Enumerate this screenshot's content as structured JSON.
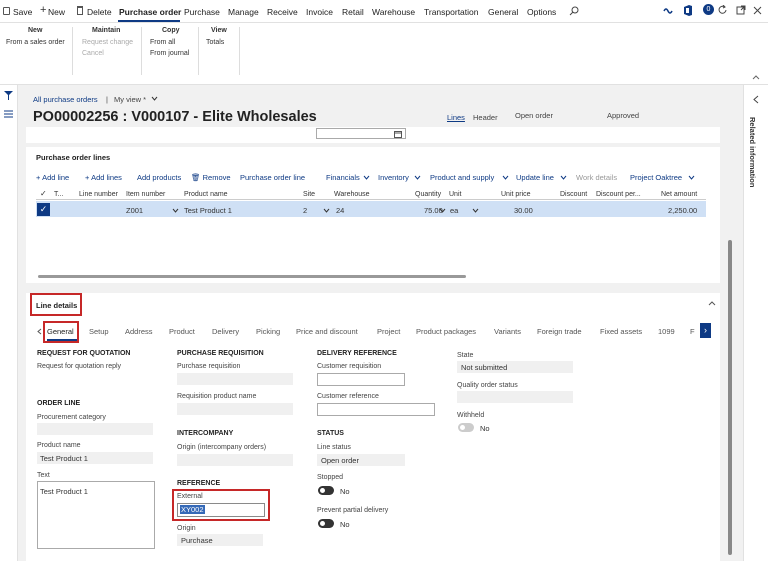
{
  "toolbar": {
    "save": "Save",
    "new": "New",
    "delete": "Delete",
    "tabs": [
      "Purchase order",
      "Purchase",
      "Manage",
      "Receive",
      "Invoice",
      "Retail",
      "Warehouse",
      "Transportation",
      "General",
      "Options"
    ],
    "badge": "0"
  },
  "ribbon": {
    "groups": [
      {
        "title": "New",
        "items": [
          "From a sales order"
        ]
      },
      {
        "title": "Maintain",
        "items": [
          "Request change",
          "Cancel"
        ]
      },
      {
        "title": "Copy",
        "items": [
          "From all",
          "From journal"
        ]
      },
      {
        "title": "View",
        "items": [
          "Totals"
        ]
      }
    ]
  },
  "breadcrumb": {
    "link": "All purchase orders",
    "sep": "|",
    "view": "My view *"
  },
  "page": {
    "title": "PO00002256 : V000107 - Elite Wholesales",
    "lines": "Lines",
    "header": "Header",
    "status1": "Open order",
    "status2": "Approved"
  },
  "lines": {
    "title": "Purchase order lines",
    "actions": [
      "Add line",
      "Add lines",
      "Add products",
      "Remove",
      "Purchase order line",
      "Financials",
      "Inventory",
      "Product and supply",
      "Update line",
      "Work details",
      "Project Oaktree"
    ],
    "columns": [
      "T...",
      "Line number",
      "Item number",
      "Product name",
      "Site",
      "Warehouse",
      "Quantity",
      "Unit",
      "Unit price",
      "Discount",
      "Discount per...",
      "Net amount"
    ],
    "row": {
      "item": "Z001",
      "product": "Test Product 1",
      "site": "2",
      "warehouse": "24",
      "quantity": "75.00",
      "unit": "ea",
      "unit_price": "30.00",
      "net": "2,250.00"
    }
  },
  "details": {
    "title": "Line details",
    "tabs": [
      "General",
      "Setup",
      "Address",
      "Product",
      "Delivery",
      "Picking",
      "Price and discount",
      "Project",
      "Product packages",
      "Variants",
      "Foreign trade",
      "Fixed assets",
      "1099",
      "F"
    ],
    "col1": {
      "rfq": "REQUEST FOR QUOTATION",
      "rfq_reply": "Request for quotation reply",
      "order_line": "ORDER LINE",
      "proc_cat": "Procurement category",
      "product_name_label": "Product name",
      "product_name": "Test Product 1",
      "text_label": "Text",
      "text_value": "Test Product 1"
    },
    "col2": {
      "preq": "PURCHASE REQUISITION",
      "preq_label": "Purchase requisition",
      "req_prod": "Requisition product name",
      "interco": "INTERCOMPANY",
      "origin_interco": "Origin (intercompany orders)",
      "reference": "REFERENCE",
      "external_label": "External",
      "external_value": "XY002",
      "origin_label": "Origin",
      "origin_value": "Purchase"
    },
    "col3": {
      "delref": "DELIVERY REFERENCE",
      "cust_req": "Customer requisition",
      "cust_ref": "Customer reference",
      "status": "STATUS",
      "line_status_label": "Line status",
      "line_status": "Open order",
      "stopped_label": "Stopped",
      "stopped_value": "No",
      "prevent_label": "Prevent partial delivery",
      "prevent_value": "No"
    },
    "col4": {
      "state_label": "State",
      "state_value": "Not submitted",
      "qo_label": "Quality order status",
      "withheld_label": "Withheld",
      "withheld_value": "No"
    }
  },
  "related": "Related information"
}
